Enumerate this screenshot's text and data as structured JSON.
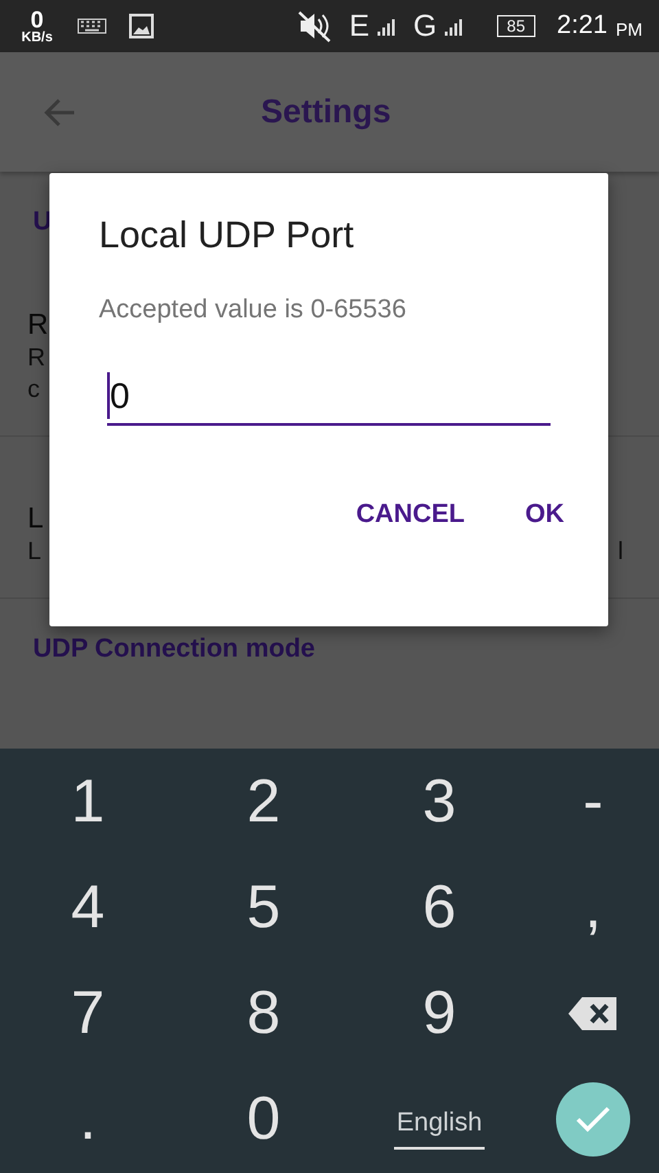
{
  "status_bar": {
    "speed": "0",
    "speed_unit": "KB/s",
    "network_1": "E",
    "network_2": "G",
    "battery": "85",
    "time": "2:21",
    "ampm": "PM"
  },
  "app_bar": {
    "title": "Settings"
  },
  "settings": [
    {
      "kind": "section",
      "title": "U"
    },
    {
      "kind": "item",
      "title": "R",
      "summary": [
        "R",
        "c"
      ]
    },
    {
      "kind": "item",
      "title": "L",
      "summary": [
        "L"
      ],
      "summary_tail": "l"
    },
    {
      "kind": "section",
      "title": "UDP Connection mode"
    }
  ],
  "dialog": {
    "title": "Local UDP Port",
    "message": "Accepted value is 0-65536",
    "field": {
      "value": "0"
    },
    "buttons": [
      "CANCEL",
      "OK"
    ]
  },
  "keyboard": [
    {
      "kind": "char",
      "label": "1"
    },
    {
      "kind": "char",
      "label": "2"
    },
    {
      "kind": "char",
      "label": "3"
    },
    {
      "kind": "char",
      "label": "-"
    },
    {
      "kind": "char",
      "label": "4"
    },
    {
      "kind": "char",
      "label": "5"
    },
    {
      "kind": "char",
      "label": "6"
    },
    {
      "kind": "char",
      "label": ","
    },
    {
      "kind": "char",
      "label": "7"
    },
    {
      "kind": "char",
      "label": "8"
    },
    {
      "kind": "char",
      "label": "9"
    },
    {
      "kind": "backspace"
    },
    {
      "kind": "char",
      "label": "."
    },
    {
      "kind": "char",
      "label": "0"
    },
    {
      "kind": "language",
      "label": "English"
    },
    {
      "kind": "done"
    }
  ]
}
